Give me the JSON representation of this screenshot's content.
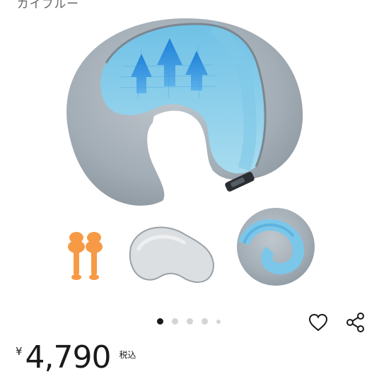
{
  "product": {
    "variant_label": "ガイブルー",
    "image_alt": "ネックピロー セット"
  },
  "gallery": {
    "dot_count": 5,
    "active_index": 0
  },
  "actions": {
    "favorite_icon": "heart-outline-icon",
    "share_icon": "share-icon"
  },
  "price": {
    "currency_symbol": "¥",
    "amount": "4,790",
    "tax_label": "税込"
  },
  "colors": {
    "pillow_gray": "#a9b3bb",
    "pillow_blue": "#8fd0ea",
    "arrow_blue": "#2b8ee0",
    "earplug_orange": "#f79a45",
    "text_dark": "#1a1a1a"
  }
}
